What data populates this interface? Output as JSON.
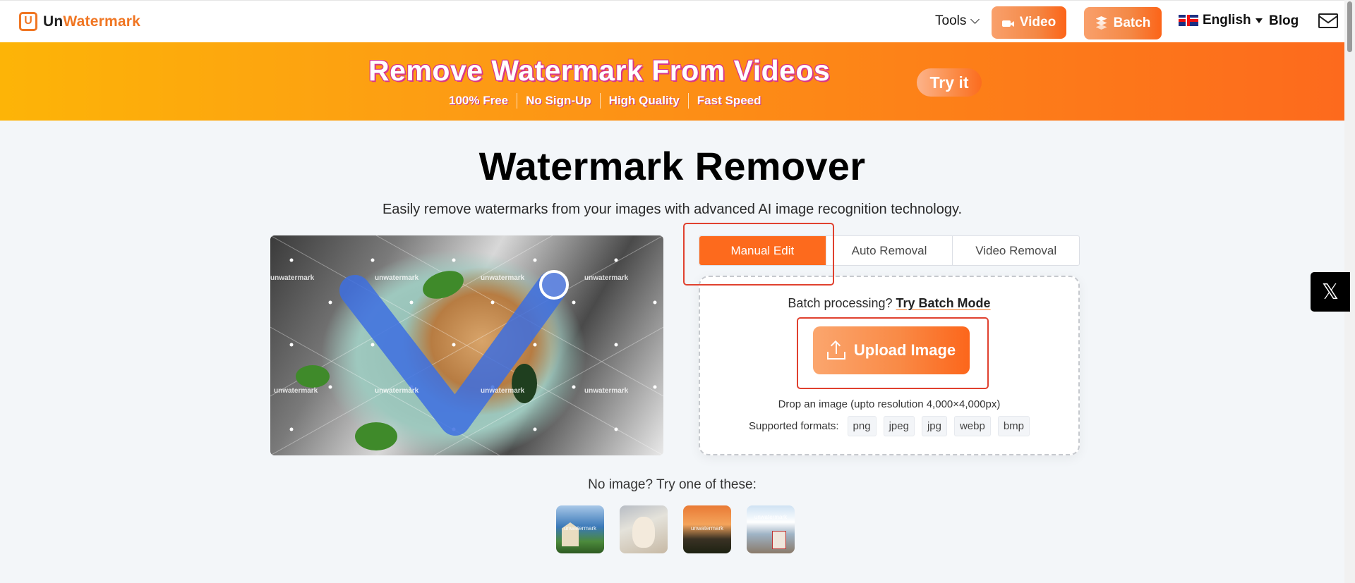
{
  "nav": {
    "brand_prefix": "Un",
    "brand_suffix": "Watermark",
    "logo_letter": "U",
    "tools_label": "Tools",
    "video_label": "Video",
    "batch_label": "Batch",
    "language_label": "English",
    "blog_label": "Blog"
  },
  "banner": {
    "title": "Remove Watermark From Videos",
    "features": [
      "100% Free",
      "No Sign-Up",
      "High Quality",
      "Fast Speed"
    ],
    "cta_label": "Try it"
  },
  "hero": {
    "title": "Watermark Remover",
    "subtitle": "Easily remove watermarks from your images with advanced AI image recognition technology."
  },
  "demo": {
    "watermark_text": "unwatermark"
  },
  "tabs": [
    {
      "label": "Manual Edit",
      "active": true
    },
    {
      "label": "Auto Removal",
      "active": false
    },
    {
      "label": "Video Removal",
      "active": false
    }
  ],
  "dropzone": {
    "batch_prompt": "Batch processing?",
    "batch_link": "Try Batch Mode",
    "upload_label": "Upload Image",
    "drop_text": "Drop an image (upto resolution 4,000×4,000px)",
    "formats_label": "Supported formats:",
    "formats": [
      "png",
      "jpeg",
      "jpg",
      "webp",
      "bmp"
    ]
  },
  "samples": {
    "prompt": "No image? Try one of these:",
    "watermark_text": "unwatermark",
    "items": [
      "house-by-sea",
      "cat",
      "sunset",
      "road-with-van"
    ]
  },
  "social": {
    "x_glyph": "𝕏"
  },
  "colors": {
    "accent": "#fd6a1d",
    "highlight_box": "#e0412f",
    "brush": "#3d6fe0"
  }
}
